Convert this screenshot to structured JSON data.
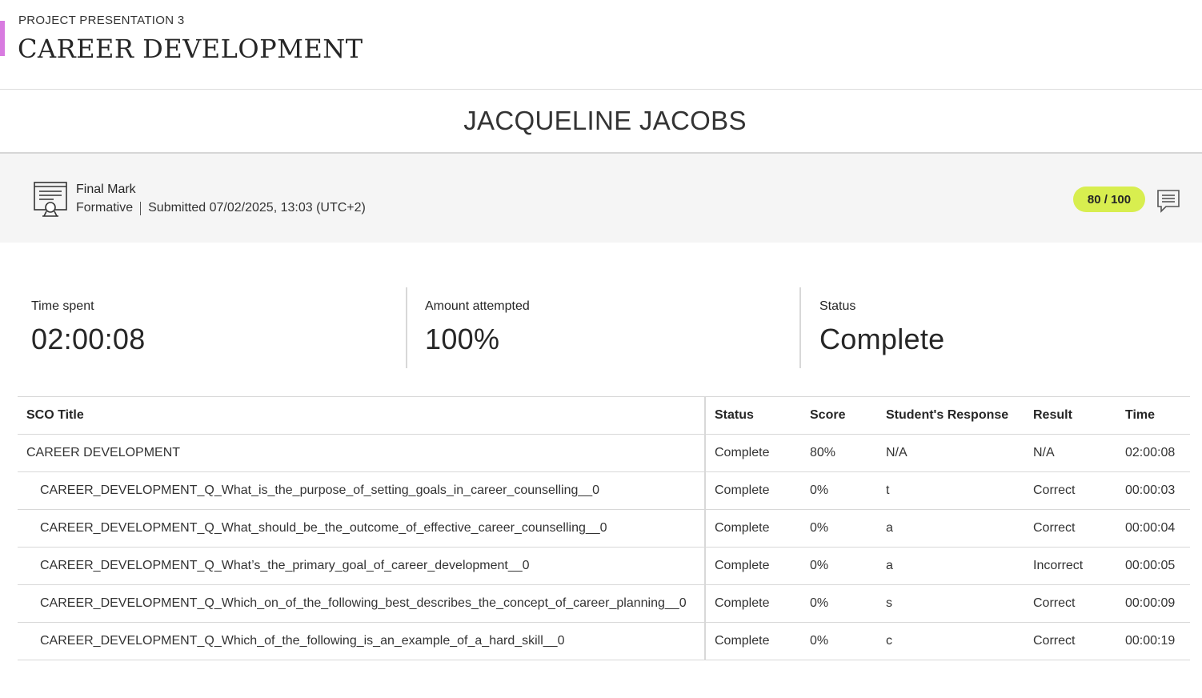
{
  "header": {
    "kicker": "PROJECT PRESENTATION 3",
    "title": "CAREER DEVELOPMENT",
    "accent_color": "#d87be0"
  },
  "student": {
    "name": "JACQUELINE JACOBS"
  },
  "mark": {
    "icon": "certificate-icon",
    "title": "Final Mark",
    "type": "Formative",
    "submitted": "Submitted 07/02/2025, 13:03 (UTC+2)",
    "score": "80 / 100",
    "score_color": "#d8ee4f",
    "feedback_icon": "comment-icon"
  },
  "stats": {
    "time_spent": {
      "label": "Time spent",
      "value": "02:00:08"
    },
    "amount_attempted": {
      "label": "Amount attempted",
      "value": "100%"
    },
    "status": {
      "label": "Status",
      "value": "Complete"
    }
  },
  "table": {
    "headers": [
      "SCO Title",
      "Status",
      "Score",
      "Student's Response",
      "Result",
      "Time"
    ],
    "rows": [
      {
        "title": "CAREER DEVELOPMENT",
        "status": "Complete",
        "score": "80%",
        "response": "N/A",
        "result": "N/A",
        "time": "02:00:08"
      },
      {
        "title": "CAREER_DEVELOPMENT_Q_What_is_the_purpose_of_setting_goals_in_career_counselling__0",
        "status": "Complete",
        "score": "0%",
        "response": "t",
        "result": "Correct",
        "time": "00:00:03"
      },
      {
        "title": "CAREER_DEVELOPMENT_Q_What_should_be_the_outcome_of_effective_career_counselling__0",
        "status": "Complete",
        "score": "0%",
        "response": "a",
        "result": "Correct",
        "time": "00:00:04"
      },
      {
        "title": "CAREER_DEVELOPMENT_Q_What’s_the_primary_goal_of_career_development__0",
        "status": "Complete",
        "score": "0%",
        "response": "a",
        "result": "Incorrect",
        "time": "00:00:05"
      },
      {
        "title": "CAREER_DEVELOPMENT_Q_Which_on_of_the_following_best_describes_the_concept_of_career_planning__0",
        "status": "Complete",
        "score": "0%",
        "response": "s",
        "result": "Correct",
        "time": "00:00:09"
      },
      {
        "title": "CAREER_DEVELOPMENT_Q_Which_of_the_following_is_an_example_of_a_hard_skill__0",
        "status": "Complete",
        "score": "0%",
        "response": "c",
        "result": "Correct",
        "time": "00:00:19"
      }
    ]
  }
}
